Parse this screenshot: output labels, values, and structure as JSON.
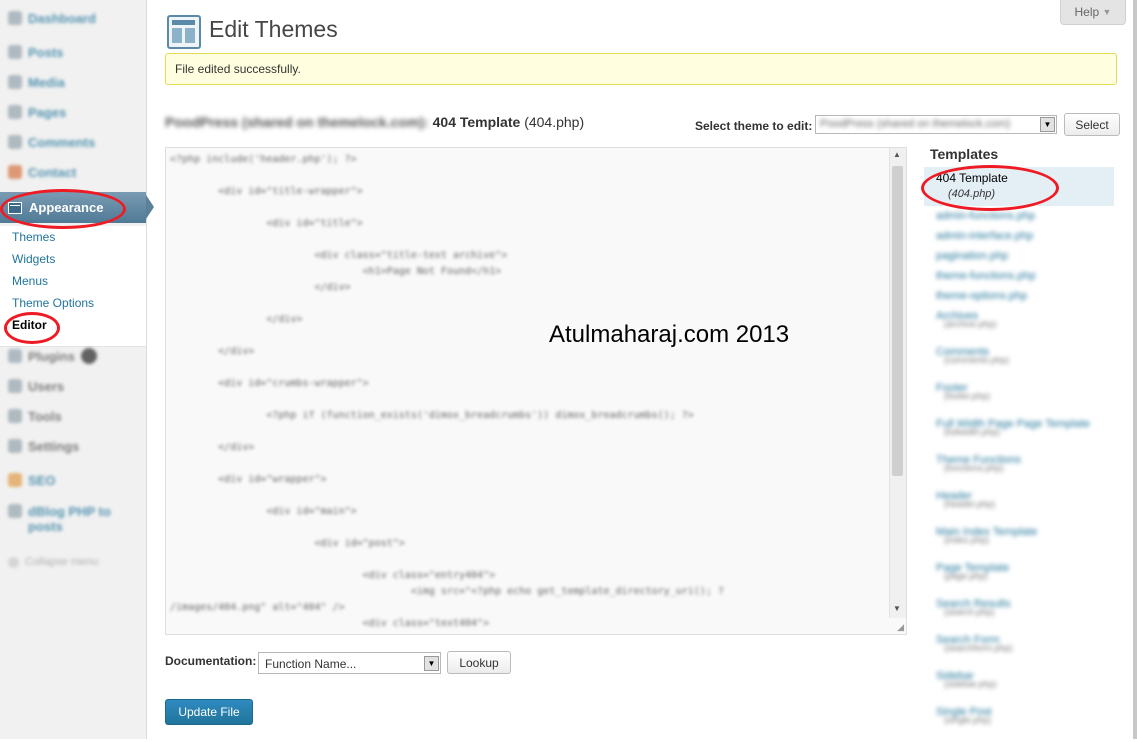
{
  "sidebar": {
    "items_top": [
      {
        "label": "Dashboard",
        "icon": "dashboard-icon"
      },
      {
        "label": "Posts",
        "icon": "pin-icon"
      },
      {
        "label": "Media",
        "icon": "media-icon"
      },
      {
        "label": "Pages",
        "icon": "pages-icon"
      },
      {
        "label": "Comments",
        "icon": "comment-icon"
      },
      {
        "label": "Contact",
        "icon": "contact-icon"
      }
    ],
    "appearance_label": "Appearance",
    "submenu": [
      "Themes",
      "Widgets",
      "Menus",
      "Theme Options",
      "Editor"
    ],
    "items_bottom": [
      {
        "label": "Plugins",
        "icon": "plugin-icon"
      },
      {
        "label": "Users",
        "icon": "users-icon"
      },
      {
        "label": "Tools",
        "icon": "tools-icon"
      },
      {
        "label": "Settings",
        "icon": "settings-icon"
      },
      {
        "label": "SEO",
        "icon": "seo-icon"
      },
      {
        "label": "dBlog PHP to posts",
        "icon": "plugin-icon"
      },
      {
        "label": "Collapse menu",
        "icon": "collapse-icon"
      }
    ]
  },
  "header": {
    "help_label": "Help",
    "title": "Edit Themes"
  },
  "notice": "File edited successfully.",
  "file_heading": {
    "theme_name": "PoodPress (shared on themelock.com):",
    "template_name": "404 Template",
    "file_name": "(404.php)"
  },
  "theme_selector": {
    "label": "Select theme to edit:",
    "value": "PoodPress (shared on themelock.com)",
    "button": "Select"
  },
  "editor": {
    "code_lines": [
      "<?php include('header.php'); ?>",
      "",
      "        <div id=\"title-wrapper\">",
      "",
      "                <div id=\"title\">",
      "",
      "                        <div class=\"title-text archive\">",
      "                                <h1>Page Not Found</h1>",
      "                        </div>",
      "",
      "                </div>",
      "",
      "        </div>",
      "",
      "        <div id=\"crumbs-wrapper\">",
      "",
      "                <?php if (function_exists('dimox_breadcrumbs')) dimox_breadcrumbs(); ?>",
      "",
      "        </div>",
      "",
      "        <div id=\"wrapper\">",
      "",
      "                <div id=\"main\">",
      "",
      "                        <div id=\"post\">",
      "",
      "                                <div class=\"entry404\">",
      "                                        <img src=\"<?php echo get_template_directory_uri(); ?",
      "/images/404.png\" alt=\"404\" />",
      "                                <div class=\"text404\">"
    ]
  },
  "watermark": "Atulmaharaj.com 2013",
  "templates": {
    "title": "Templates",
    "active": {
      "name": "404 Template",
      "file": "(404.php)"
    },
    "others": [
      {
        "name": "admin-functions.php",
        "file": ""
      },
      {
        "name": "admin-interface.php",
        "file": ""
      },
      {
        "name": "pagination.php",
        "file": ""
      },
      {
        "name": "theme-functions.php",
        "file": ""
      },
      {
        "name": "theme-options.php",
        "file": ""
      },
      {
        "name": "Archives",
        "file": "(archive.php)"
      },
      {
        "name": "Comments",
        "file": "(comments.php)"
      },
      {
        "name": "Footer",
        "file": "(footer.php)"
      },
      {
        "name": "Full Width Page Page Template",
        "file": "(fullwidth.php)"
      },
      {
        "name": "Theme Functions",
        "file": "(functions.php)"
      },
      {
        "name": "Header",
        "file": "(header.php)"
      },
      {
        "name": "Main Index Template",
        "file": "(index.php)"
      },
      {
        "name": "Page Template",
        "file": "(page.php)"
      },
      {
        "name": "Search Results",
        "file": "(search.php)"
      },
      {
        "name": "Search Form",
        "file": "(searchform.php)"
      },
      {
        "name": "Sidebar",
        "file": "(sidebar.php)"
      },
      {
        "name": "Single Post",
        "file": "(single.php)"
      }
    ]
  },
  "documentation": {
    "label": "Documentation:",
    "select_value": "Function Name...",
    "lookup_button": "Lookup"
  },
  "update_button": "Update File"
}
